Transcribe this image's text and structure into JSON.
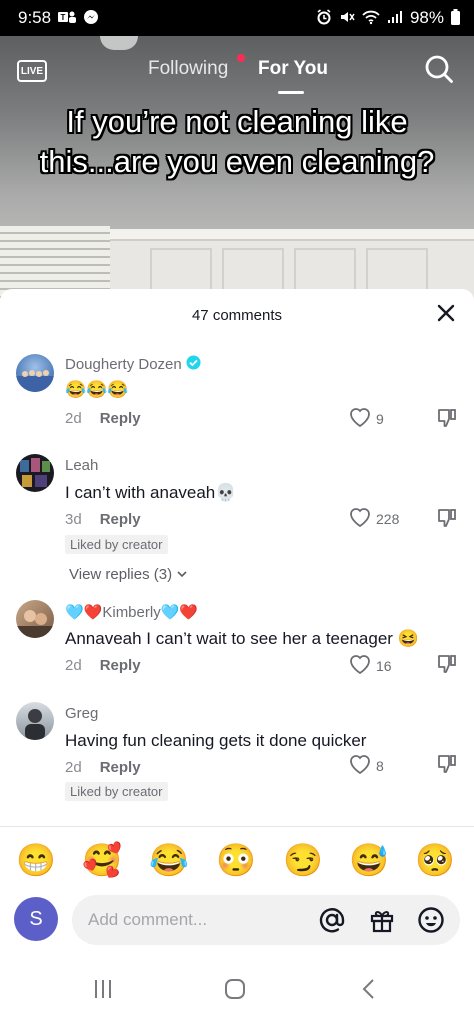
{
  "status_bar": {
    "time": "9:58",
    "left_icons": [
      "teams-icon",
      "messenger-icon"
    ],
    "right_icons": [
      "alarm-icon",
      "mute-icon",
      "wifi-icon",
      "signal-icon"
    ],
    "battery": "98%"
  },
  "video": {
    "tabs": [
      {
        "label": "Following",
        "has_notification_dot": true
      },
      {
        "label": "For You",
        "active": true
      }
    ],
    "live_label": "LIVE",
    "caption": "If you’re not cleaning like this...are you even cleaning?"
  },
  "comments_sheet": {
    "count_label": "47 comments",
    "comments": [
      {
        "username": "Dougherty Dozen",
        "verified": true,
        "text": "😂😂😂",
        "age": "2d",
        "reply_label": "Reply",
        "likes": "9",
        "liked_by_creator": ""
      },
      {
        "username": "Leah",
        "verified": false,
        "text": "I can’t with anaveah💀",
        "age": "3d",
        "reply_label": "Reply",
        "likes": "228",
        "liked_by_creator": "Liked by creator",
        "view_replies": "View replies (3)"
      },
      {
        "username": "🩵❤️Kimberly🩵❤️",
        "verified": false,
        "text": "Annaveah I can’t wait to see her a teenager 😆",
        "age": "2d",
        "reply_label": "Reply",
        "likes": "16",
        "liked_by_creator": ""
      },
      {
        "username": "Greg",
        "verified": false,
        "text": "Having fun cleaning gets it done quicker",
        "age": "2d",
        "reply_label": "Reply",
        "likes": "8",
        "liked_by_creator": "Liked by creator"
      }
    ]
  },
  "emoji_bar": [
    "😁",
    "🥰",
    "😂",
    "😳",
    "😏",
    "😅",
    "🥺"
  ],
  "comment_input": {
    "avatar_letter": "S",
    "placeholder": "Add comment...",
    "icons": [
      "mention-icon",
      "gift-icon",
      "emoji-icon"
    ]
  },
  "colors": {
    "accent": "#fe2c55",
    "verified": "#20d5ec",
    "avatar_bg": "#5b5fc7",
    "input_bg": "#f1f1f2"
  }
}
